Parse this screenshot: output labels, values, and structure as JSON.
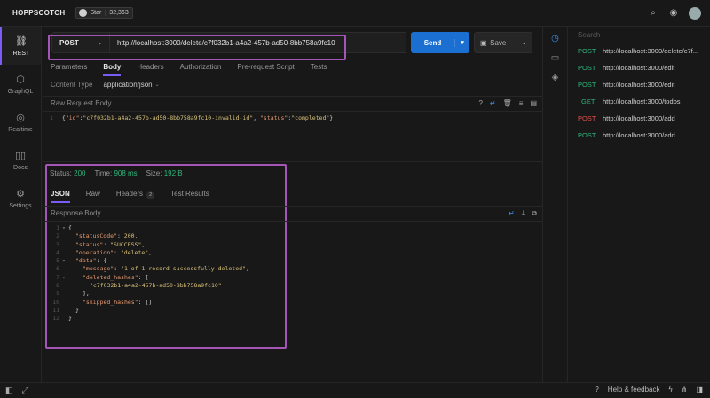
{
  "app": {
    "brand": "HOPPSCOTCH",
    "star_label": "Star",
    "star_count": "32,363"
  },
  "sidenav": [
    {
      "label": "REST",
      "icon": "link-icon",
      "glyph": "⛓"
    },
    {
      "label": "GraphQL",
      "icon": "graphql-icon",
      "glyph": "⬡"
    },
    {
      "label": "Realtime",
      "icon": "globe-icon",
      "glyph": "◎"
    },
    {
      "label": "Docs",
      "icon": "book-icon",
      "glyph": "▯▯"
    },
    {
      "label": "Settings",
      "icon": "gear-icon",
      "glyph": "⚙"
    }
  ],
  "request": {
    "method": "POST",
    "url": "http://localhost:3000/delete/c7f032b1-a4a2-457b-ad50-8bb758a9fc10",
    "send_label": "Send",
    "save_label": "Save",
    "tabs": [
      "Parameters",
      "Body",
      "Headers",
      "Authorization",
      "Pre-request Script",
      "Tests"
    ],
    "active_tab": "Body",
    "content_type_label": "Content Type",
    "content_type_value": "application/json",
    "raw_body_label": "Raw Request Body",
    "raw_body_line": "1",
    "raw_body": {
      "k1": "\"id\"",
      "v1": "\"c7f032b1-a4a2-457b-ad50-8bb758a9fc10-invalid-id\"",
      "k2": "\"status\"",
      "v2": "\"completed\""
    }
  },
  "response": {
    "status_label": "Status:",
    "status_value": "200",
    "time_label": "Time:",
    "time_value": "908 ms",
    "size_label": "Size:",
    "size_value": "192 B",
    "tabs": [
      "JSON",
      "Raw",
      "Headers",
      "Test Results"
    ],
    "headers_badge": "2",
    "body_label": "Response Body",
    "lines": [
      {
        "n": "1",
        "fold": "▾",
        "html": "{"
      },
      {
        "n": "2",
        "key": "\"statusCode\"",
        "val": "200,",
        "indent": 1
      },
      {
        "n": "3",
        "key": "\"status\"",
        "val": "\"SUCCESS\",",
        "indent": 1
      },
      {
        "n": "4",
        "key": "\"operation\"",
        "val": "\"delete\",",
        "indent": 1
      },
      {
        "n": "5",
        "fold": "▾",
        "key": "\"data\"",
        "val": "{",
        "indent": 1
      },
      {
        "n": "6",
        "key": "\"message\"",
        "val": "\"1 of 1 record successfully deleted\",",
        "indent": 2
      },
      {
        "n": "7",
        "fold": "▾",
        "key": "\"deleted_hashes\"",
        "val": "[",
        "indent": 2
      },
      {
        "n": "8",
        "val": "\"c7f032b1-a4a2-457b-ad50-8bb758a9fc10\"",
        "indent": 3
      },
      {
        "n": "9",
        "val": "],",
        "indent": 2
      },
      {
        "n": "10",
        "key": "\"skipped_hashes\"",
        "val": "[]",
        "indent": 2
      },
      {
        "n": "11",
        "val": "}",
        "indent": 1
      },
      {
        "n": "12",
        "val": "}",
        "indent": 0
      }
    ]
  },
  "history": {
    "search_placeholder": "Search",
    "items": [
      {
        "method": "POST",
        "url": "http://localhost:3000/delete/c7f..."
      },
      {
        "method": "POST",
        "url": "http://localhost:3000/edit"
      },
      {
        "method": "POST",
        "url": "http://localhost:3000/edit"
      },
      {
        "method": "GET",
        "url": "http://localhost:3000/todos"
      },
      {
        "method": "POST",
        "url": "http://localhost:3000/add"
      },
      {
        "method": "POST",
        "url": "http://localhost:3000/add"
      }
    ]
  },
  "footer": {
    "help_label": "Help & feedback"
  },
  "colors": {
    "accent": "#7c5cf7",
    "send": "#1b6fd1",
    "success": "#2fb57c",
    "highlight": "#a455b5"
  }
}
